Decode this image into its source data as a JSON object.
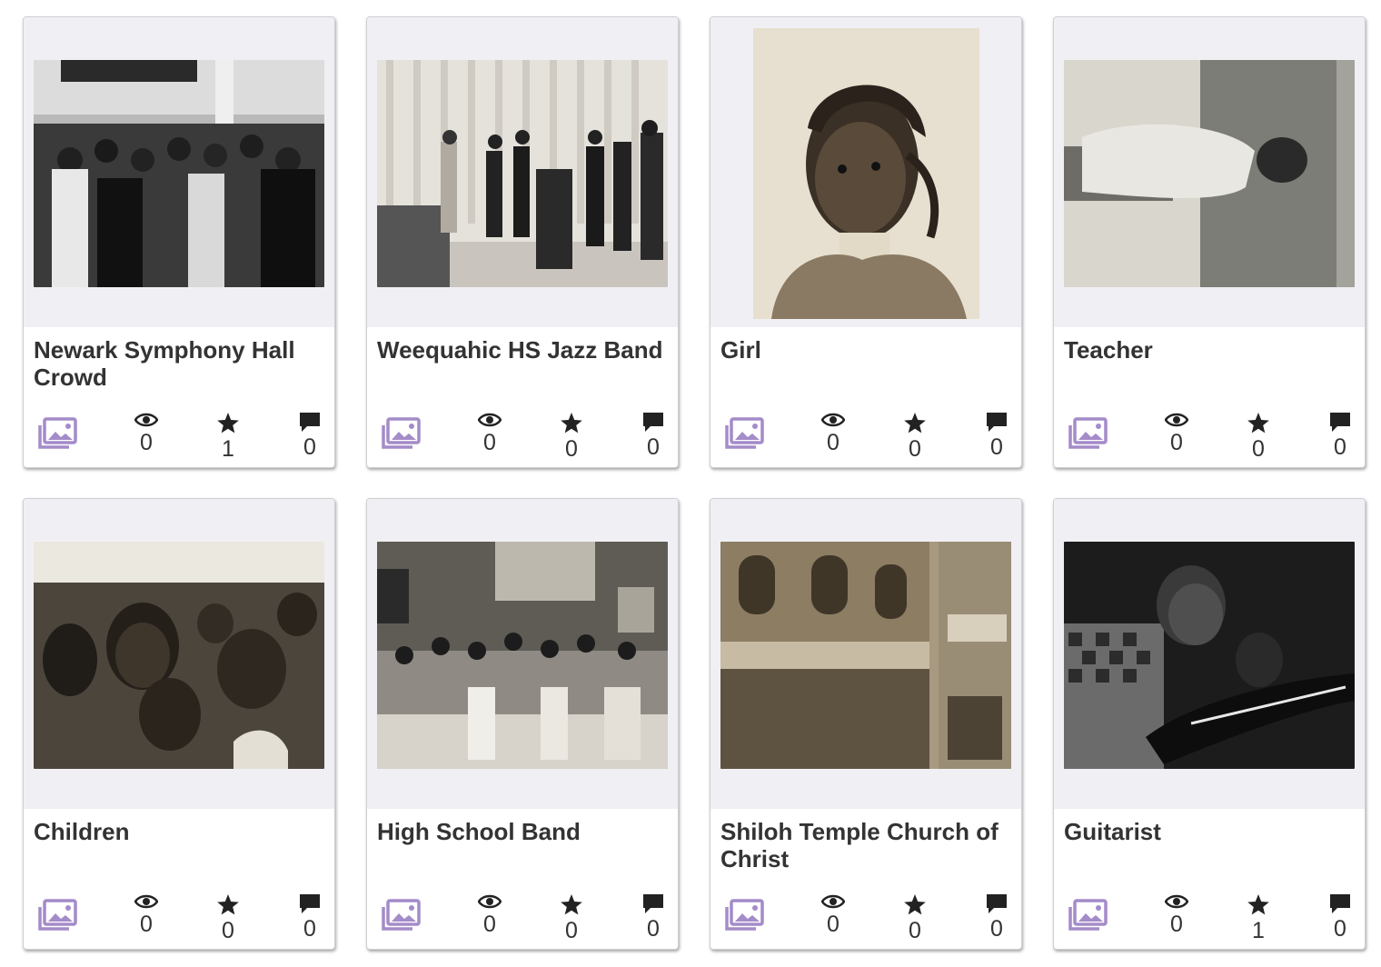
{
  "colors": {
    "accent_purple": "#a48bc9",
    "card_bg": "#ffffff",
    "thumb_bg": "#f0f0f4",
    "text": "#333333"
  },
  "icons": {
    "type": "image-gallery-icon",
    "views": "eye-icon",
    "stars": "star-icon",
    "comments": "comment-icon"
  },
  "cards": [
    {
      "title": "Newark Symphony Hall Crowd",
      "views": "0",
      "stars": "1",
      "comments": "0"
    },
    {
      "title": "Weequahic HS Jazz Band",
      "views": "0",
      "stars": "0",
      "comments": "0"
    },
    {
      "title": "Girl",
      "views": "0",
      "stars": "0",
      "comments": "0"
    },
    {
      "title": "Teacher",
      "views": "0",
      "stars": "0",
      "comments": "0"
    },
    {
      "title": "Children",
      "views": "0",
      "stars": "0",
      "comments": "0"
    },
    {
      "title": "High School Band",
      "views": "0",
      "stars": "0",
      "comments": "0"
    },
    {
      "title": "Shiloh Temple Church of Christ",
      "views": "0",
      "stars": "0",
      "comments": "0"
    },
    {
      "title": "Guitarist",
      "views": "0",
      "stars": "1",
      "comments": "0"
    }
  ]
}
